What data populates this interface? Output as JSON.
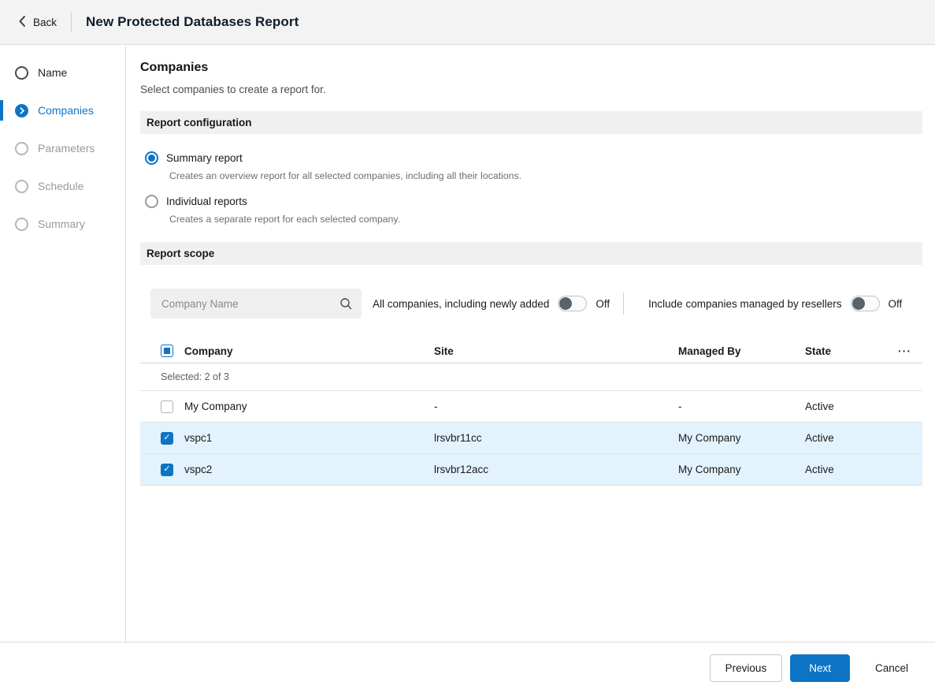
{
  "header": {
    "back_label": "Back",
    "title": "New Protected Databases Report"
  },
  "sidebar": {
    "steps": [
      {
        "label": "Name",
        "state": "done"
      },
      {
        "label": "Companies",
        "state": "active"
      },
      {
        "label": "Parameters",
        "state": "pending"
      },
      {
        "label": "Schedule",
        "state": "pending"
      },
      {
        "label": "Summary",
        "state": "pending"
      }
    ]
  },
  "main": {
    "title": "Companies",
    "subtitle": "Select companies to create a report for.",
    "report_configuration": {
      "section_title": "Report configuration",
      "options": [
        {
          "label": "Summary report",
          "description": "Creates an overview report for all selected companies, including all their locations.",
          "selected": true
        },
        {
          "label": "Individual reports",
          "description": "Creates a separate report for each selected company.",
          "selected": false
        }
      ]
    },
    "report_scope": {
      "section_title": "Report scope",
      "search_placeholder": "Company Name",
      "toggles": [
        {
          "label": "All companies, including newly added",
          "state": "Off",
          "on": false
        },
        {
          "label": "Include companies managed by resellers",
          "state": "Off",
          "on": false
        }
      ],
      "table": {
        "columns": {
          "company": "Company",
          "site": "Site",
          "managed_by": "Managed By",
          "state": "State"
        },
        "selected_summary": "Selected: 2 of 3",
        "rows": [
          {
            "checked": false,
            "company": "My Company",
            "site": "-",
            "managed_by": "-",
            "state": "Active"
          },
          {
            "checked": true,
            "company": "vspc1",
            "site": "lrsvbr11cc",
            "managed_by": "My Company",
            "state": "Active"
          },
          {
            "checked": true,
            "company": "vspc2",
            "site": "lrsvbr12acc",
            "managed_by": "My Company",
            "state": "Active"
          }
        ]
      }
    }
  },
  "footer": {
    "previous_label": "Previous",
    "next_label": "Next",
    "cancel_label": "Cancel"
  },
  "icons": {
    "ellipsis": "···"
  },
  "colors": {
    "accent": "#0d74c5",
    "row_selected": "#e3f3fd"
  }
}
